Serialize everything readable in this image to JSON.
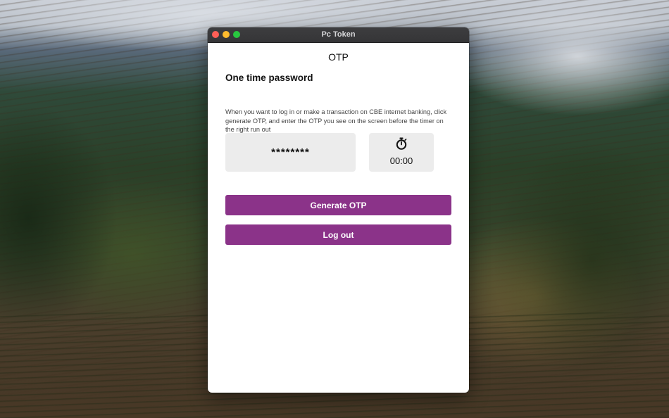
{
  "window": {
    "title": "Pc Token"
  },
  "screen": {
    "title": "OTP",
    "heading": "One time password",
    "description": "When you want to log in or make a transaction on CBE internet banking, click generate OTP, and enter the OTP you see on the screen before the timer on the right run out"
  },
  "otp": {
    "value": "********"
  },
  "timer": {
    "icon": "stopwatch-icon",
    "value": "00:00"
  },
  "buttons": {
    "generate_label": "Generate OTP",
    "logout_label": "Log out"
  },
  "colors": {
    "accent": "#8b3389",
    "box_background": "#ececec",
    "close": "#fe5f57",
    "minimize": "#febc2e",
    "maximize": "#28c840"
  }
}
